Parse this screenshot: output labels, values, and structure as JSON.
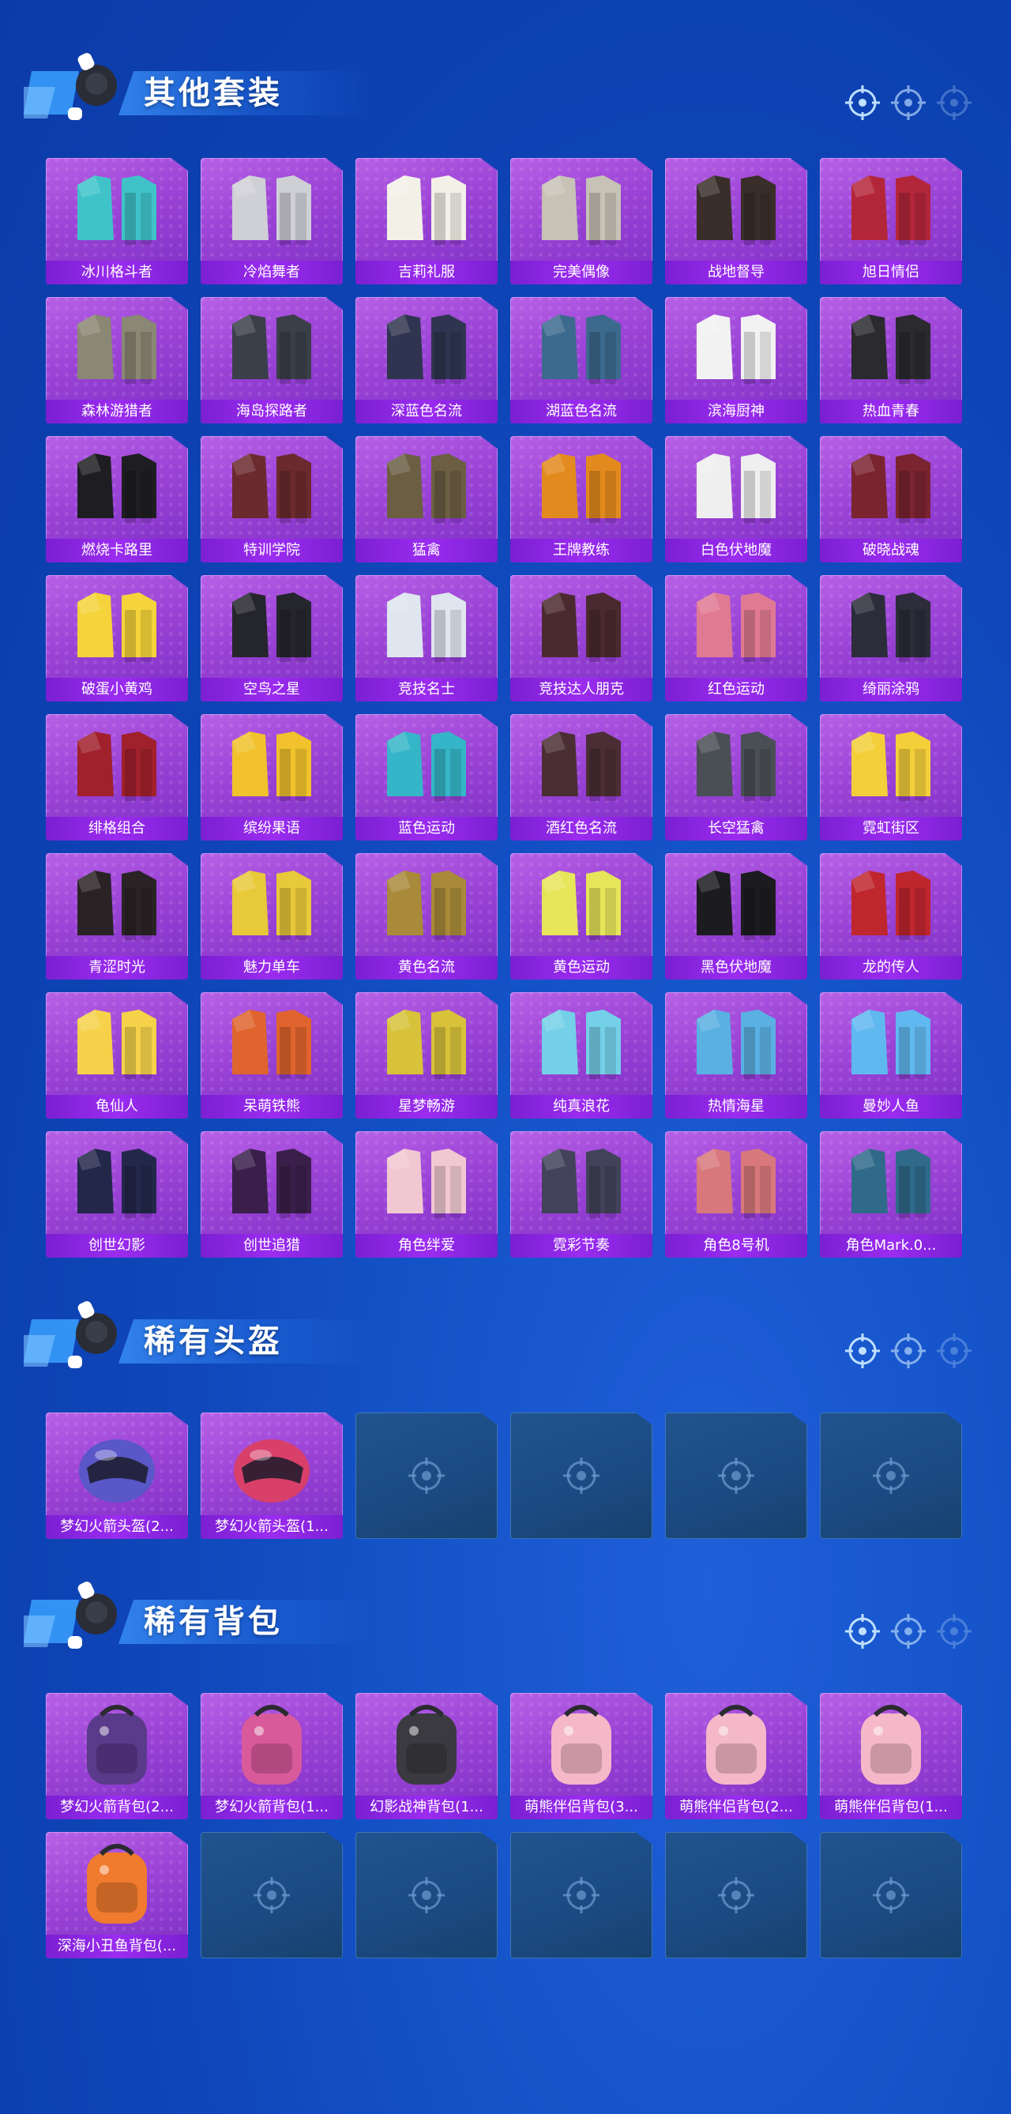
{
  "colors": {
    "background": "#1553c9",
    "card_purple": "#9a43d6",
    "label_purple": "#8a25e0",
    "empty_slot": "#1b4a82"
  },
  "sections": [
    {
      "title": "其他套装",
      "items": [
        {
          "label": "冰川格斗者",
          "icon": "outfit-icon",
          "tint": "#3fc3c9"
        },
        {
          "label": "冷焰舞者",
          "icon": "outfit-icon",
          "tint": "#cfcfd6"
        },
        {
          "label": "吉莉礼服",
          "icon": "outfit-icon",
          "tint": "#f3f0e8"
        },
        {
          "label": "完美偶像",
          "icon": "outfit-icon",
          "tint": "#c7c2b6"
        },
        {
          "label": "战地督导",
          "icon": "outfit-icon",
          "tint": "#3a2e2a"
        },
        {
          "label": "旭日情侣",
          "icon": "outfit-icon",
          "tint": "#b3263a"
        },
        {
          "label": "森林游猎者",
          "icon": "outfit-icon",
          "tint": "#8a8774"
        },
        {
          "label": "海岛探路者",
          "icon": "outfit-icon",
          "tint": "#3b3f4a"
        },
        {
          "label": "深蓝色名流",
          "icon": "outfit-icon",
          "tint": "#2f3550"
        },
        {
          "label": "湖蓝色名流",
          "icon": "outfit-icon",
          "tint": "#3c6a8e"
        },
        {
          "label": "滨海厨神",
          "icon": "outfit-icon",
          "tint": "#f2f2f2"
        },
        {
          "label": "热血青春",
          "icon": "outfit-icon",
          "tint": "#2a2a2f"
        },
        {
          "label": "燃烧卡路里",
          "icon": "outfit-icon",
          "tint": "#1e1e22"
        },
        {
          "label": "特训学院",
          "icon": "outfit-icon",
          "tint": "#6b2a2e"
        },
        {
          "label": "猛禽",
          "icon": "outfit-icon",
          "tint": "#6b5e43"
        },
        {
          "label": "王牌教练",
          "icon": "outfit-icon",
          "tint": "#e38a1e"
        },
        {
          "label": "白色伏地魔",
          "icon": "outfit-icon",
          "tint": "#efefef"
        },
        {
          "label": "破晓战魂",
          "icon": "outfit-icon",
          "tint": "#7a2430"
        },
        {
          "label": "破蛋小黄鸡",
          "icon": "outfit-icon",
          "tint": "#f4d43a"
        },
        {
          "label": "空鸟之星",
          "icon": "outfit-icon",
          "tint": "#25252c"
        },
        {
          "label": "竞技名士",
          "icon": "outfit-icon",
          "tint": "#dfe6ef"
        },
        {
          "label": "竞技达人朋克",
          "icon": "outfit-icon",
          "tint": "#4a2a2e"
        },
        {
          "label": "红色运动",
          "icon": "outfit-icon",
          "tint": "#e07a92"
        },
        {
          "label": "绮丽涂鸦",
          "icon": "outfit-icon",
          "tint": "#2c2c3a"
        },
        {
          "label": "绯格组合",
          "icon": "outfit-icon",
          "tint": "#a0202c"
        },
        {
          "label": "缤纷果语",
          "icon": "outfit-icon",
          "tint": "#f1c22c"
        },
        {
          "label": "蓝色运动",
          "icon": "outfit-icon",
          "tint": "#35b6c8"
        },
        {
          "label": "酒红色名流",
          "icon": "outfit-icon",
          "tint": "#4a2e34"
        },
        {
          "label": "长空猛禽",
          "icon": "outfit-icon",
          "tint": "#4a4f55"
        },
        {
          "label": "霓虹街区",
          "icon": "outfit-icon",
          "tint": "#f3cf3a"
        },
        {
          "label": "青涩时光",
          "icon": "outfit-icon",
          "tint": "#2a2326"
        },
        {
          "label": "魅力单车",
          "icon": "outfit-icon",
          "tint": "#e8c93a"
        },
        {
          "label": "黄色名流",
          "icon": "outfit-icon",
          "tint": "#a88a3a"
        },
        {
          "label": "黄色运动",
          "icon": "outfit-icon",
          "tint": "#e7e55a"
        },
        {
          "label": "黑色伏地魔",
          "icon": "outfit-icon",
          "tint": "#1c1c20"
        },
        {
          "label": "龙的传人",
          "icon": "outfit-icon",
          "tint": "#c0262e"
        },
        {
          "label": "龟仙人",
          "icon": "outfit-icon",
          "tint": "#f5d24a"
        },
        {
          "label": "呆萌铁熊",
          "icon": "outfit-icon",
          "tint": "#e0642e"
        },
        {
          "label": "星梦畅游",
          "icon": "outfit-icon",
          "tint": "#d8c23a"
        },
        {
          "label": "纯真浪花",
          "icon": "outfit-icon",
          "tint": "#74d0e8"
        },
        {
          "label": "热情海星",
          "icon": "outfit-icon",
          "tint": "#5ab0e2"
        },
        {
          "label": "曼妙人鱼",
          "icon": "outfit-icon",
          "tint": "#60b8f0"
        },
        {
          "label": "创世幻影",
          "icon": "outfit-icon",
          "tint": "#23274a"
        },
        {
          "label": "创世追猎",
          "icon": "outfit-icon",
          "tint": "#3a1f4a"
        },
        {
          "label": "角色绊爱",
          "icon": "outfit-icon",
          "tint": "#f1c8d2"
        },
        {
          "label": "霓彩节奏",
          "icon": "outfit-icon",
          "tint": "#42425a"
        },
        {
          "label": "角色8号机",
          "icon": "outfit-icon",
          "tint": "#d8787c"
        },
        {
          "label": "角色Mark.0...",
          "icon": "outfit-icon",
          "tint": "#2f6a8a"
        }
      ],
      "empty_slots": 0
    },
    {
      "title": "稀有头盔",
      "items": [
        {
          "label": "梦幻火箭头盔(2...",
          "icon": "helmet-icon",
          "tint": "#5a57c8"
        },
        {
          "label": "梦幻火箭头盔(1...",
          "icon": "helmet-icon",
          "tint": "#d8406a"
        }
      ],
      "empty_slots": 4
    },
    {
      "title": "稀有背包",
      "items": [
        {
          "label": "梦幻火箭背包(2...",
          "icon": "backpack-icon",
          "tint": "#5a3a8a"
        },
        {
          "label": "梦幻火箭背包(1...",
          "icon": "backpack-icon",
          "tint": "#d85a9a"
        },
        {
          "label": "幻影战神背包(1...",
          "icon": "backpack-icon",
          "tint": "#3a3a40"
        },
        {
          "label": "萌熊伴侣背包(3...",
          "icon": "backpack-icon",
          "tint": "#f4b8c8"
        },
        {
          "label": "萌熊伴侣背包(2...",
          "icon": "backpack-icon",
          "tint": "#f4b8c8"
        },
        {
          "label": "萌熊伴侣背包(1...",
          "icon": "backpack-icon",
          "tint": "#f4b8c8"
        },
        {
          "label": "深海小丑鱼背包(...",
          "icon": "backpack-icon",
          "tint": "#f07a2e"
        }
      ],
      "empty_slots": 5
    }
  ]
}
